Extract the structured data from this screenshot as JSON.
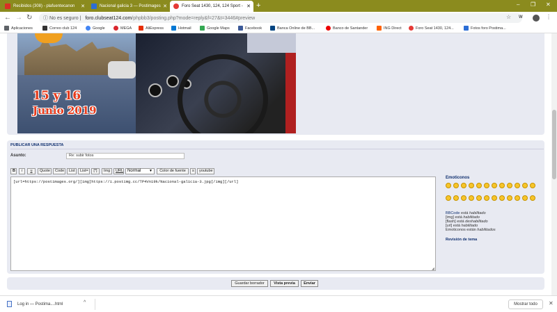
{
  "browser": {
    "tabs": [
      {
        "title": "Recibidos (308) - plafuentecanon",
        "favicon_color": "#d93025"
      },
      {
        "title": "Nacional galicia 3 — Postimages",
        "favicon_color": "#2c6ed5"
      },
      {
        "title": "Foro Seat 1430, 124, 124 Sport -",
        "favicon_color": "#e53935"
      }
    ],
    "new_tab_glyph": "+",
    "security_label": "No es seguro",
    "url_host": "foro.clubseat124.com",
    "url_path": "/phpbb3/posting.php?mode=reply&f=27&t=3446#preview",
    "window_controls": [
      "–",
      "❐",
      "✕"
    ],
    "bookmarks": [
      {
        "label": "Aplicaciones",
        "color": "#5f6368"
      },
      {
        "label": "Correo club 124",
        "color": "#333333"
      },
      {
        "label": "Google",
        "color": "#4285f4"
      },
      {
        "label": "MEGA",
        "color": "#d9272e"
      },
      {
        "label": "AliExpress",
        "color": "#e62e04"
      },
      {
        "label": "Hotmail",
        "color": "#0078d4"
      },
      {
        "label": "Google Maps",
        "color": "#34a853"
      },
      {
        "label": "Facebook",
        "color": "#3b5998"
      },
      {
        "label": "Banca Online de BB...",
        "color": "#004481"
      },
      {
        "label": "Banco de Santander",
        "color": "#ec0000"
      },
      {
        "label": "ING Direct",
        "color": "#ff6200"
      },
      {
        "label": "Foro Seat 1430, 124...",
        "color": "#e53935"
      },
      {
        "label": "Fotos foro Postima...",
        "color": "#2c6ed5"
      }
    ]
  },
  "poster": {
    "date_line1": "15 y 16",
    "date_line2": "Junio 2019"
  },
  "form": {
    "section_title": "PUBLICAR UNA RESPUESTA",
    "subject_label": "Asunto:",
    "subject_value": "Re: subir fotos",
    "toolbar": [
      "B",
      "i",
      "u",
      "Quote",
      "Code",
      "List",
      "List=",
      "[*]",
      "Img",
      "URL"
    ],
    "font_size_selected": "Normal",
    "toolbar_right": [
      "Color de fuente",
      "s",
      "youtube"
    ],
    "message": "[url=https://postimages.org/][img]https://i.postimg.cc/TP4Vn19k/Nacional-galicia-3.jpg[/img][/url]"
  },
  "sidebar": {
    "emoticons_title": "Emoticonos",
    "emoticon_count": 24,
    "status_lines": [
      {
        "label": "BBCode",
        "rest": " está ",
        "state": "habilitado"
      },
      {
        "label": "[img]",
        "rest": " está ",
        "state": "habilitado"
      },
      {
        "label": "[flash]",
        "rest": " está ",
        "state": "deshabilitado"
      },
      {
        "label": "[url]",
        "rest": " está ",
        "state": "habilitado"
      },
      {
        "label": "Emoticonos",
        "rest": " están ",
        "state": "habilitados"
      }
    ],
    "review_label": "Revisión de tema"
  },
  "actions": {
    "save_draft": "Guardar borrador",
    "preview": "Vista previa",
    "submit": "Enviar"
  },
  "downloads": {
    "file": "Log in — Postima....html",
    "show_all": "Mostrar todo"
  }
}
